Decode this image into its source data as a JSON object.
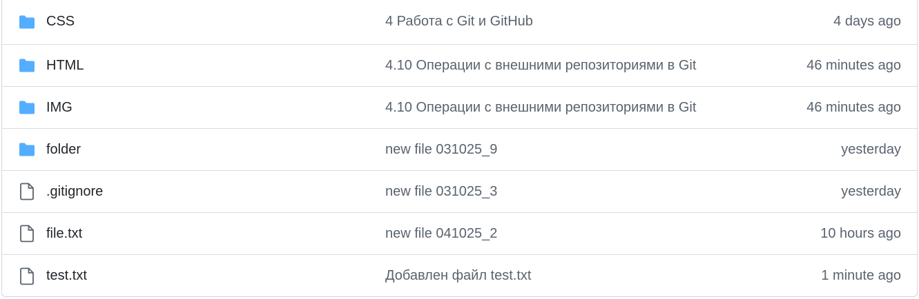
{
  "files": [
    {
      "name": "CSS",
      "type": "folder",
      "icon": "folder-icon",
      "commit": "4 Работа с Git и GitHub",
      "date": "4 days ago"
    },
    {
      "name": "HTML",
      "type": "folder",
      "icon": "folder-icon",
      "commit": "4.10 Операции с внешними репозиториями в Git",
      "date": "46 minutes ago"
    },
    {
      "name": "IMG",
      "type": "folder",
      "icon": "folder-icon",
      "commit": "4.10 Операции с внешними репозиториями в Git",
      "date": "46 minutes ago"
    },
    {
      "name": "folder",
      "type": "folder",
      "icon": "folder-icon",
      "commit": "new file 031025_9",
      "date": "yesterday"
    },
    {
      "name": ".gitignore",
      "type": "file",
      "icon": "file-icon",
      "commit": "new file 031025_3",
      "date": "yesterday"
    },
    {
      "name": "file.txt",
      "type": "file",
      "icon": "file-icon",
      "commit": "new file 041025_2",
      "date": "10 hours ago"
    },
    {
      "name": "test.txt",
      "type": "file",
      "icon": "file-icon",
      "commit": "Добавлен файл test.txt",
      "date": "1 minute ago"
    }
  ],
  "colors": {
    "folder": "#54aeff",
    "file": "#59636e",
    "border": "#d0d7de"
  }
}
